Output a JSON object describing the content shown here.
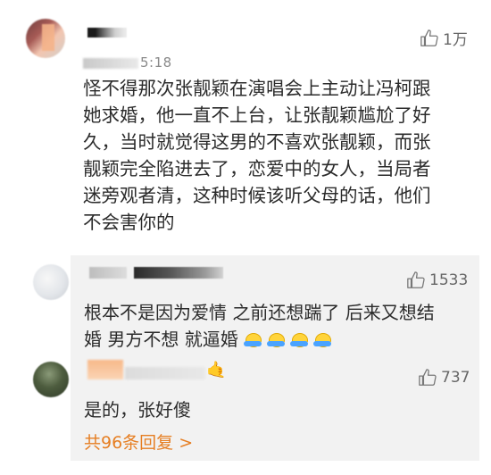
{
  "main_comment": {
    "time_visible": "5:18",
    "likes": "1万",
    "content": "怪不得那次张靓颖在演唱会上主动让冯柯跟\n她求婚，他一直不上台，让张靓颖尴尬了好\n久，当时就觉得这男的不喜欢张靓颖，而张\n靓颖完全陷进去了，恋爱中的女人，当局者\n迷旁观者清，这种时候该听父母的话，他们\n不会害你的"
  },
  "replies": [
    {
      "likes": "1533",
      "content_line1": "根本不是因为爱情 之前还想踹了 后来又想结",
      "content_line2": "婚 男方不想 就逼婚",
      "emoji": [
        "pray-emoji",
        "pray-emoji",
        "pray-emoji",
        "pray-emoji"
      ]
    },
    {
      "likes": "737",
      "content": "是的，张好傻",
      "badge": "🤙"
    }
  ],
  "more_replies_label": "共96条回复 >",
  "colors": {
    "reply_bg": "#f2f2f2",
    "link_orange": "#e67e22",
    "text": "#2b2b2b",
    "meta": "#8a8a8a"
  }
}
